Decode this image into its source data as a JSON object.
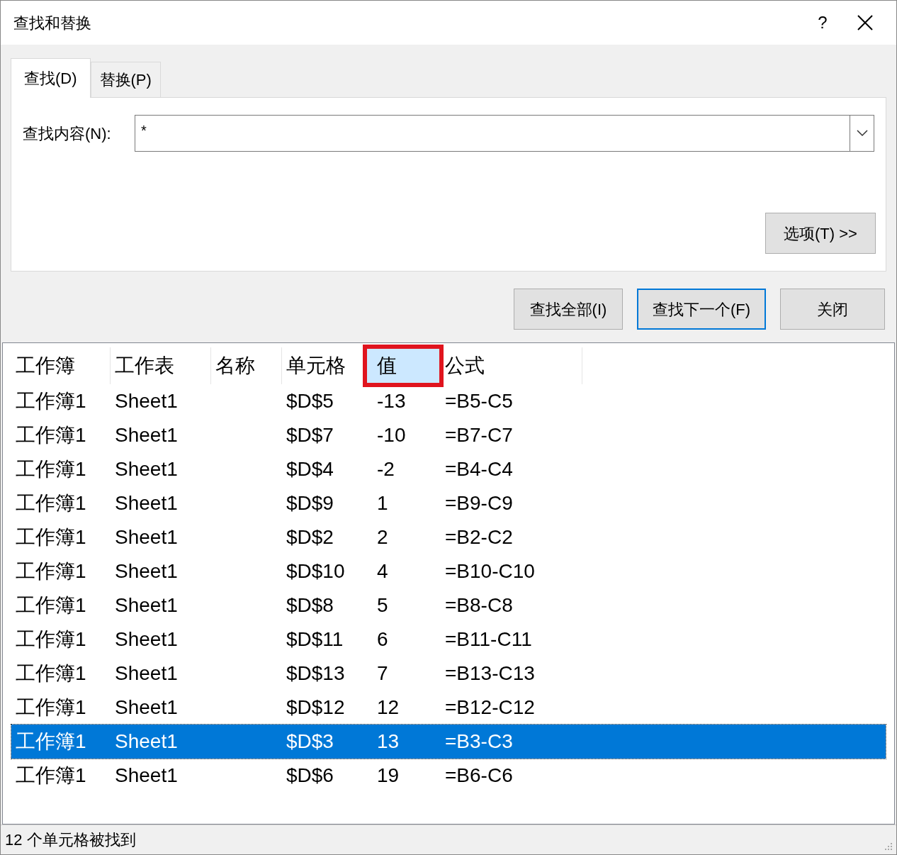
{
  "window": {
    "title": "查找和替换",
    "help": "?"
  },
  "tabs": [
    {
      "label": "查找(D)",
      "selected": true
    },
    {
      "label": "替换(P)",
      "selected": false
    }
  ],
  "find": {
    "label": "查找内容(N):",
    "value": "*"
  },
  "options_button": "选项(T) >>",
  "buttons": [
    {
      "label": "查找全部(I)",
      "default": false
    },
    {
      "label": "查找下一个(F)",
      "default": true
    },
    {
      "label": "关闭",
      "default": false
    }
  ],
  "table": {
    "columns": [
      {
        "label": "工作簿",
        "highlighted": false
      },
      {
        "label": "工作表",
        "highlighted": false
      },
      {
        "label": "名称",
        "highlighted": false
      },
      {
        "label": "单元格",
        "highlighted": false
      },
      {
        "label": "值",
        "highlighted": true
      },
      {
        "label": "公式",
        "highlighted": false
      }
    ],
    "rows": [
      {
        "cells": [
          "工作簿1",
          "Sheet1",
          "",
          "$D$5",
          "-13",
          "=B5-C5"
        ],
        "selected": false
      },
      {
        "cells": [
          "工作簿1",
          "Sheet1",
          "",
          "$D$7",
          "-10",
          "=B7-C7"
        ],
        "selected": false
      },
      {
        "cells": [
          "工作簿1",
          "Sheet1",
          "",
          "$D$4",
          "-2",
          "=B4-C4"
        ],
        "selected": false
      },
      {
        "cells": [
          "工作簿1",
          "Sheet1",
          "",
          "$D$9",
          "1",
          "=B9-C9"
        ],
        "selected": false
      },
      {
        "cells": [
          "工作簿1",
          "Sheet1",
          "",
          "$D$2",
          "2",
          "=B2-C2"
        ],
        "selected": false
      },
      {
        "cells": [
          "工作簿1",
          "Sheet1",
          "",
          "$D$10",
          "4",
          "=B10-C10"
        ],
        "selected": false
      },
      {
        "cells": [
          "工作簿1",
          "Sheet1",
          "",
          "$D$8",
          "5",
          "=B8-C8"
        ],
        "selected": false
      },
      {
        "cells": [
          "工作簿1",
          "Sheet1",
          "",
          "$D$11",
          "6",
          "=B11-C11"
        ],
        "selected": false
      },
      {
        "cells": [
          "工作簿1",
          "Sheet1",
          "",
          "$D$13",
          "7",
          "=B13-C13"
        ],
        "selected": false
      },
      {
        "cells": [
          "工作簿1",
          "Sheet1",
          "",
          "$D$12",
          "12",
          "=B12-C12"
        ],
        "selected": false
      },
      {
        "cells": [
          "工作簿1",
          "Sheet1",
          "",
          "$D$3",
          "13",
          "=B3-C3"
        ],
        "selected": true
      },
      {
        "cells": [
          "工作簿1",
          "Sheet1",
          "",
          "$D$6",
          "19",
          "=B6-C6"
        ],
        "selected": false
      }
    ]
  },
  "status_bar": "12 个单元格被找到"
}
